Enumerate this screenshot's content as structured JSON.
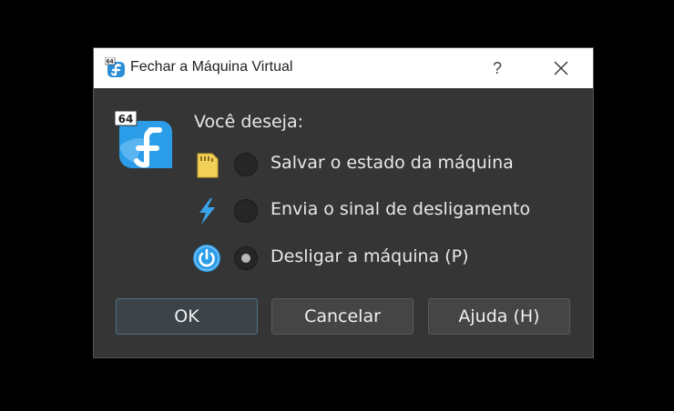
{
  "window": {
    "title": "Fechar a Máquina Virtual",
    "help_label": "?",
    "app_icon_badge": "64"
  },
  "dialog": {
    "badge": "64",
    "question": "Você deseja:",
    "options": [
      {
        "label": "Salvar o estado da máquina",
        "icon": "sd-card-icon",
        "selected": false
      },
      {
        "label": "Envia o sinal de desligamento",
        "icon": "lightning-icon",
        "selected": false
      },
      {
        "label": "Desligar a máquina (P)",
        "icon": "power-icon",
        "selected": true
      }
    ]
  },
  "buttons": {
    "ok": "OK",
    "cancel": "Cancelar",
    "help": "Ajuda (H)"
  },
  "colors": {
    "dialog_bg": "#353535",
    "accent_blue": "#2b9de8",
    "default_button_border": "#4f7286"
  }
}
